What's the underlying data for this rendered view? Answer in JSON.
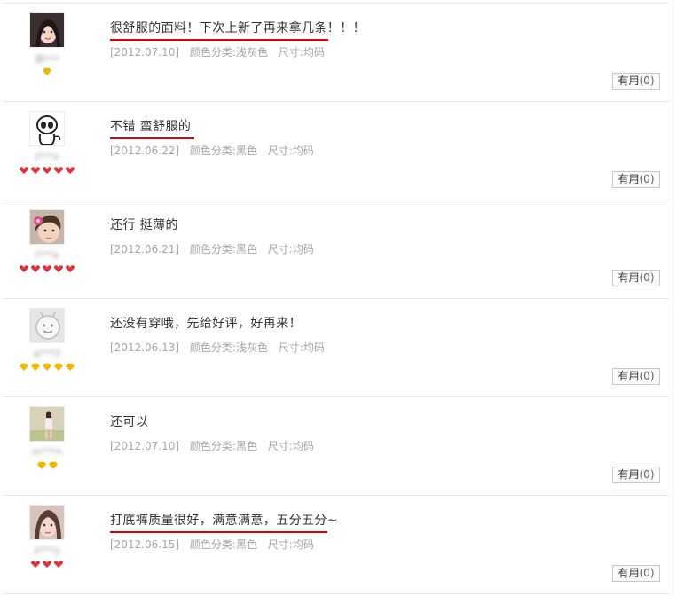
{
  "reviews": [
    {
      "comment": "很舒服的面料！下次上新了再来拿几条！！！",
      "date": "[2012.07.10]",
      "color_label": "颜色分类:浅灰色",
      "size_label": "尺寸:均码",
      "user": "葛***",
      "useful_label": "有用",
      "useful_count": "(0)",
      "rank_icon": "yellow-diamond",
      "rank_count": 1,
      "avatar": "photo-girl-dark-hair",
      "highlighted": true
    },
    {
      "comment": "不错 蛮舒服的",
      "date": "[2012.06.22]",
      "color_label": "颜色分类:黑色",
      "size_label": "尺寸:均码",
      "user": "j***o",
      "useful_label": "有用",
      "useful_count": "(0)",
      "rank_icon": "red-heart",
      "rank_count": 5,
      "avatar": "cartoon-ghost",
      "highlighted": true
    },
    {
      "comment": "还行 挺薄的",
      "date": "[2012.06.21]",
      "color_label": "颜色分类:黑色",
      "size_label": "尺寸:均码",
      "user": "l***a",
      "useful_label": "有用",
      "useful_count": "(0)",
      "rank_icon": "red-heart",
      "rank_count": 5,
      "avatar": "photo-child-flower",
      "highlighted": false
    },
    {
      "comment": "还没有穿哦，先给好评，好再来！",
      "date": "[2012.06.13]",
      "color_label": "颜色分类:浅灰色",
      "size_label": "尺寸:均码",
      "user": "q***2",
      "useful_label": "有用",
      "useful_count": "(0)",
      "rank_icon": "yellow-diamond",
      "rank_count": 5,
      "avatar": "default-smiley",
      "highlighted": false
    },
    {
      "comment": "还可以",
      "date": "[2012.07.10]",
      "color_label": "颜色分类:黑色",
      "size_label": "尺寸:均码",
      "user": "m***n",
      "useful_label": "有用",
      "useful_count": "(0)",
      "rank_icon": "yellow-diamond",
      "rank_count": 2,
      "avatar": "photo-standing-girl",
      "highlighted": false
    },
    {
      "comment": "打底裤质量很好，满意满意，五分五分~",
      "date": "[2012.06.15]",
      "color_label": "颜色分类:黑色",
      "size_label": "尺寸:均码",
      "user": "x***y",
      "useful_label": "有用",
      "useful_count": "(0)",
      "rank_icon": "red-heart",
      "rank_count": 3,
      "avatar": "photo-girl-portrait",
      "highlighted": true
    }
  ],
  "colors": {
    "underline": "#e00000",
    "meta_text": "#a6a6a6",
    "divider": "#e4e4e4",
    "red_heart": "#e0303a",
    "yellow_diamond": "#f2b600"
  }
}
